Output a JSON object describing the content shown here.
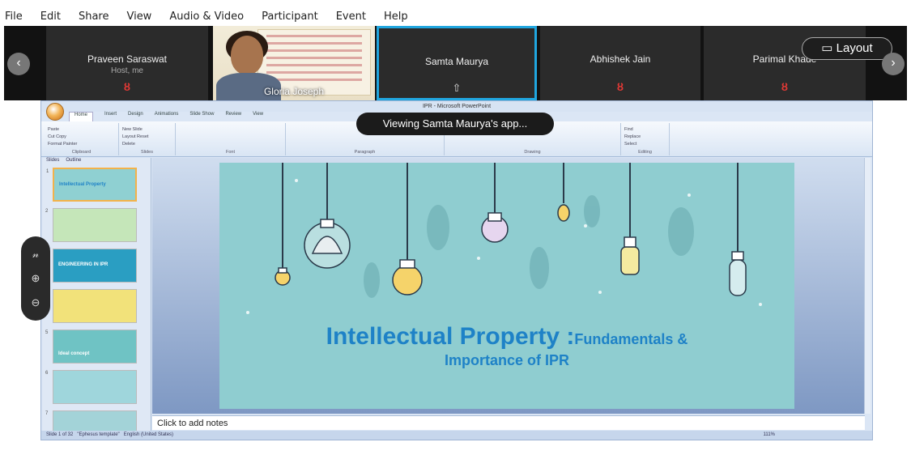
{
  "menu": [
    {
      "label": "File"
    },
    {
      "label": "Edit"
    },
    {
      "label": "Share"
    },
    {
      "label": "View"
    },
    {
      "label": "Audio & Video"
    },
    {
      "label": "Participant"
    },
    {
      "label": "Event"
    },
    {
      "label": "Help"
    }
  ],
  "participants": [
    {
      "name": "Praveen Saraswat",
      "sub": "Host, me",
      "mic": "muted"
    },
    {
      "name": "Gloria Joseph",
      "video": true
    },
    {
      "name": "Samta Maurya",
      "state": "sharing",
      "selected": true
    },
    {
      "name": "Abhishek Jain",
      "mic": "muted"
    },
    {
      "name": "Parimal Khade",
      "mic": "muted"
    }
  ],
  "layout_button": {
    "label": "Layout",
    "icon": "layout-icon"
  },
  "viewing_banner": "Viewing Samta Maurya's app...",
  "powerpoint": {
    "window_title": "IPR - Microsoft PowerPoint",
    "ribbon_tabs": [
      "Home",
      "Insert",
      "Design",
      "Animations",
      "Slide Show",
      "Review",
      "View"
    ],
    "ribbon_groups": [
      "Clipboard",
      "Slides",
      "Font",
      "Paragraph",
      "Drawing",
      "Editing"
    ],
    "clipboard_items": [
      "Cut",
      "Copy",
      "Format Painter"
    ],
    "paste_label": "Paste",
    "slides_items": [
      "Layout",
      "Reset",
      "Delete"
    ],
    "new_slide_label": "New Slide",
    "editing_items": [
      "Find",
      "Replace",
      "Select"
    ],
    "pane_tabs": [
      "Slides",
      "Outline"
    ],
    "thumbnails": [
      {
        "n": "1",
        "text": "Intellectual Property",
        "color": "#8fd0d2"
      },
      {
        "n": "2",
        "text": "",
        "color": "#c5e6b9"
      },
      {
        "n": "3",
        "text": "ENGINEERING IN IPR",
        "color": "#2a9ec2"
      },
      {
        "n": "4",
        "text": "",
        "color": "#f2e27a"
      },
      {
        "n": "5",
        "text": "Ideal concept",
        "color": "#6fc3c4"
      },
      {
        "n": "6",
        "text": "",
        "color": "#9fd6dc"
      },
      {
        "n": "7",
        "text": "",
        "color": "#a3d3d8"
      }
    ],
    "slide": {
      "title_main": "Intellectual Property :",
      "title_rest": "Fundamentals &",
      "subtitle": "Importance of IPR",
      "bg_color": "#8fcdd0",
      "accent_color": "#1e82c7"
    },
    "notes_placeholder": "Click to add notes",
    "status": {
      "slide": "Slide 1 of 32",
      "theme": "\"Ephesus template\"",
      "language": "English (United States)",
      "zoom": "111%"
    }
  },
  "colors": {
    "sharing_border": "#20a6df",
    "muted_mic": "#e53935"
  }
}
